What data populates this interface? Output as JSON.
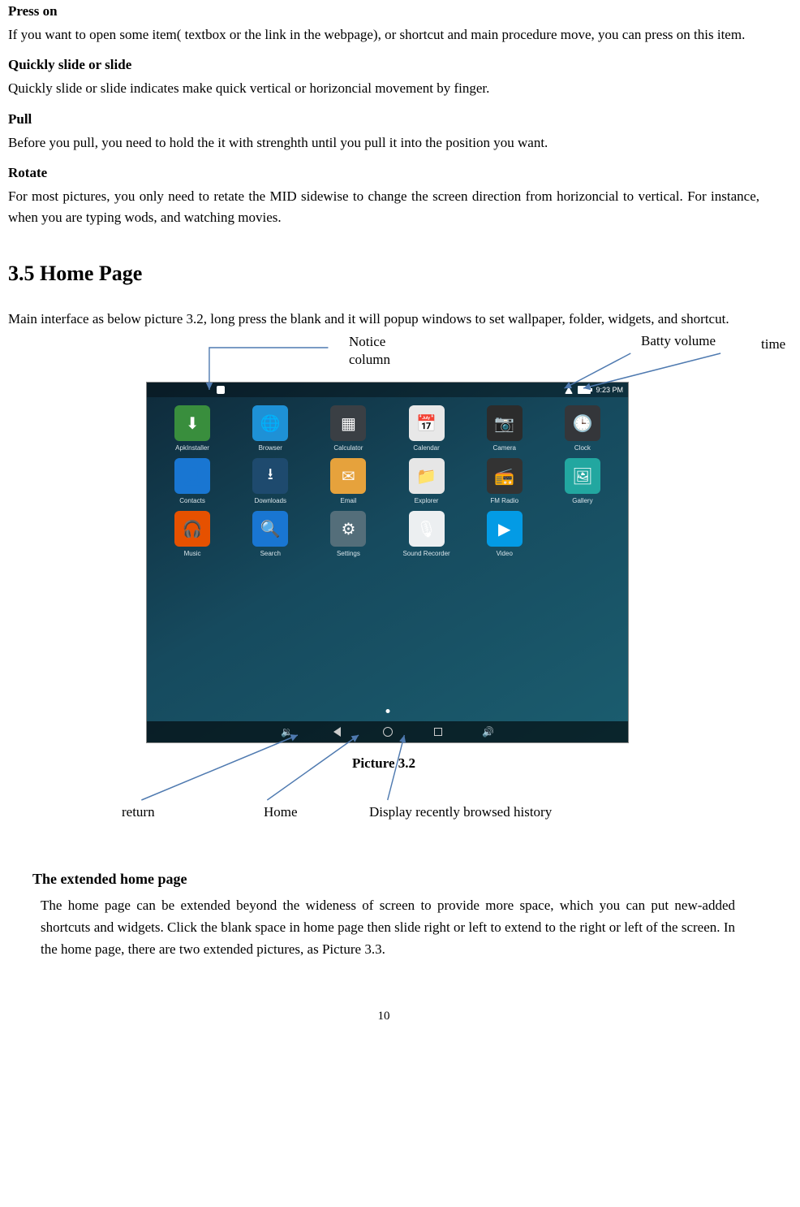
{
  "sections": {
    "press_on": {
      "title": "Press on",
      "body": "If you want to open some item( textbox or the link in the webpage), or shortcut and main procedure move, you can press on this item."
    },
    "slide": {
      "title": "Quickly slide or slide",
      "body": "Quickly slide or slide indicates make quick vertical or horizoncial movement by finger."
    },
    "pull": {
      "title": "Pull",
      "body": "Before you pull, you need to hold the it with strenghth until you pull it into the position you want."
    },
    "rotate": {
      "title": "Rotate",
      "body": "For most pictures, you only need to retate the MID sidewise to change the screen direction from horizoncial to vertical. For instance, when you are typing wods, and watching movies."
    },
    "home": {
      "title": "3.5 Home Page",
      "intro": "Main interface as below picture 3.2, long press the blank and it will popup windows to set wallpaper, folder, widgets, and shortcut."
    },
    "extended": {
      "title": "The extended home page",
      "body": "The home page can be extended beyond the wideness of screen to provide more space, which you can put new-added shortcuts and widgets. Click the blank space in home page then slide right or left to extend to the right or left of the screen. In the home page, there are two extended pictures, as Picture 3.3."
    }
  },
  "callouts": {
    "notice": "Notice column",
    "battery": "Batty volume",
    "time": "time",
    "return": "return",
    "home": "Home",
    "recent": "Display recently browsed history",
    "caption": "Picture 3.2"
  },
  "statusbar": {
    "time": "9:23 PM"
  },
  "apps": [
    {
      "label": "ApkInstaller",
      "bg": "#398e3d",
      "glyph": "⬇"
    },
    {
      "label": "Browser",
      "bg": "#1e91d6",
      "glyph": "🌐"
    },
    {
      "label": "Calculator",
      "bg": "#3a3f44",
      "glyph": "▦"
    },
    {
      "label": "Calendar",
      "bg": "#e8e8e8",
      "glyph": "📅"
    },
    {
      "label": "Camera",
      "bg": "#2c2c2c",
      "glyph": "📷"
    },
    {
      "label": "Clock",
      "bg": "#34363a",
      "glyph": "🕒"
    },
    {
      "label": "Contacts",
      "bg": "#1976d2",
      "glyph": "👤"
    },
    {
      "label": "Downloads",
      "bg": "#1e4a6e",
      "glyph": "⭳"
    },
    {
      "label": "Email",
      "bg": "#e6a23c",
      "glyph": "✉"
    },
    {
      "label": "Explorer",
      "bg": "#e6e6e6",
      "glyph": "📁"
    },
    {
      "label": "FM Radio",
      "bg": "#333",
      "glyph": "📻"
    },
    {
      "label": "Gallery",
      "bg": "#22a7a0",
      "glyph": "🖼"
    },
    {
      "label": "Music",
      "bg": "#e65100",
      "glyph": "🎧"
    },
    {
      "label": "Search",
      "bg": "#1976d2",
      "glyph": "🔍"
    },
    {
      "label": "Settings",
      "bg": "#546e7a",
      "glyph": "⚙"
    },
    {
      "label": "Sound Recorder",
      "bg": "#eceff1",
      "glyph": "🎙"
    },
    {
      "label": "Video",
      "bg": "#039be5",
      "glyph": "▶"
    }
  ],
  "page_number": "10"
}
